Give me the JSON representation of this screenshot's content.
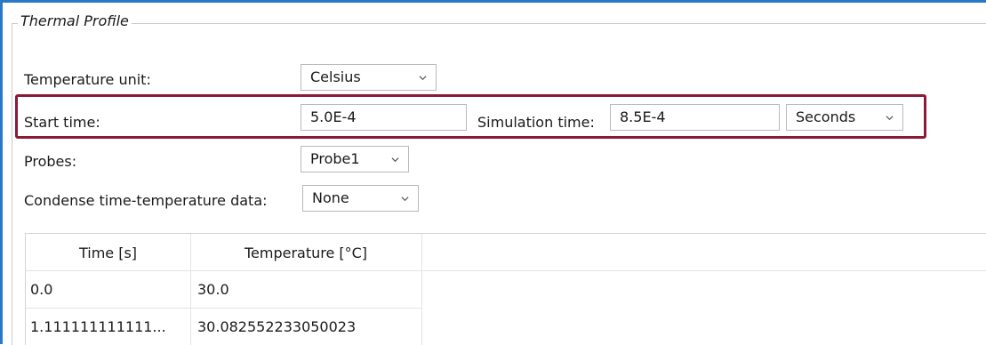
{
  "group": {
    "title": "Thermal Profile"
  },
  "temperature_unit": {
    "label": "Temperature unit:",
    "value": "Celsius"
  },
  "start_time": {
    "label": "Start time:",
    "value": "5.0E-4"
  },
  "simulation_time": {
    "label": "Simulation time:",
    "value": "8.5E-4",
    "unit": "Seconds"
  },
  "probes": {
    "label": "Probes:",
    "value": "Probe1"
  },
  "condense": {
    "label": "Condense time-temperature data:",
    "value": "None"
  },
  "table": {
    "headers": [
      "Time [s]",
      "Temperature [°C]"
    ],
    "rows": [
      [
        "0.0",
        "30.0"
      ],
      [
        "1.111111111111...",
        "30.082552233050023"
      ]
    ]
  },
  "colors": {
    "accent": "#2a78c8",
    "highlight": "#8b1a36",
    "border": "#b9b9b9"
  },
  "icons": {
    "dropdown": "chevron-down-icon"
  }
}
